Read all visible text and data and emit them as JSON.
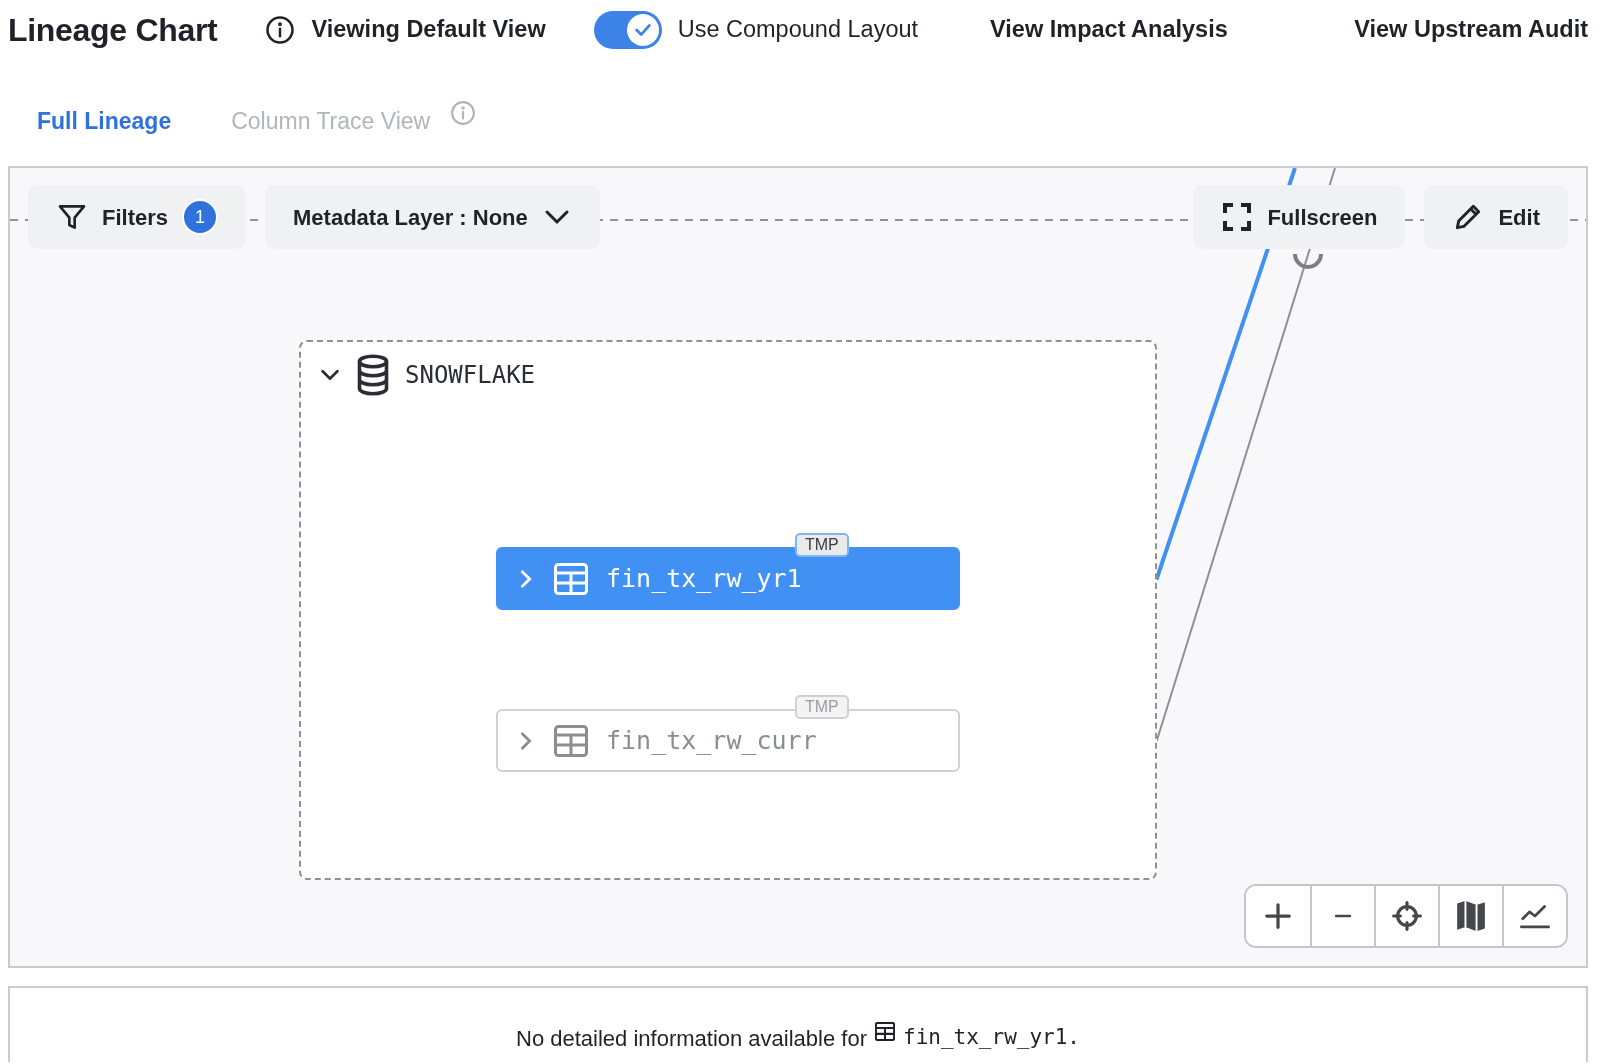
{
  "header": {
    "title": "Lineage Chart",
    "view_label": "Viewing Default View",
    "compound_toggle": {
      "label": "Use Compound Layout",
      "on": true
    },
    "links": [
      "View Impact Analysis",
      "View Upstream Audit"
    ]
  },
  "tabs": [
    {
      "label": "Full Lineage",
      "selected": true
    },
    {
      "label": "Column Trace View",
      "selected": false
    }
  ],
  "toolbar": {
    "filters": {
      "label": "Filters",
      "count": "1"
    },
    "metadata_layer": "Metadata Layer : None",
    "fullscreen": "Fullscreen",
    "edit": "Edit"
  },
  "group": {
    "name": "SNOWFLAKE",
    "expanded": true
  },
  "nodes": [
    {
      "name": "fin_tx_rw_yr1",
      "tag": "TMP",
      "selected": true
    },
    {
      "name": "fin_tx_rw_curr",
      "tag": "TMP",
      "selected": false
    }
  ],
  "detail": {
    "message": "No detailed information available for",
    "entity": "fin_tx_rw_yr1."
  }
}
